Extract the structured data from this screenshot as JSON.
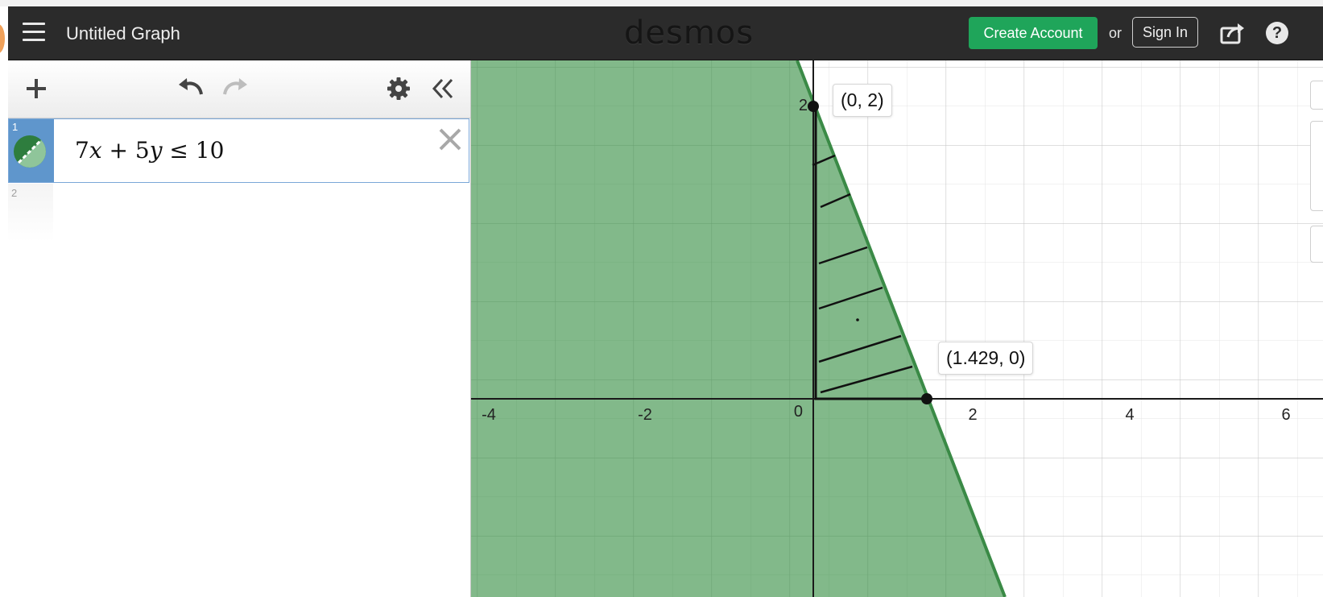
{
  "header": {
    "title": "Untitled Graph",
    "brand": "desmos",
    "create_account": "Create Account",
    "or": "or",
    "sign_in": "Sign In",
    "help": "?"
  },
  "expressions": [
    {
      "index": "1",
      "color": "#2e7d3e"
    },
    {
      "index": "2"
    }
  ],
  "graph": {
    "x_ticks": [
      "-4",
      "-2",
      "0",
      "2",
      "4",
      "6"
    ],
    "y_tick": "2",
    "point_labels": [
      "(0, 2)",
      "(1.429, 0)"
    ]
  },
  "colors": {
    "fill": "#2e8b3c",
    "boundary": "#3a8a46",
    "header": "#2b2b2b",
    "accent": "#1fa55a"
  }
}
